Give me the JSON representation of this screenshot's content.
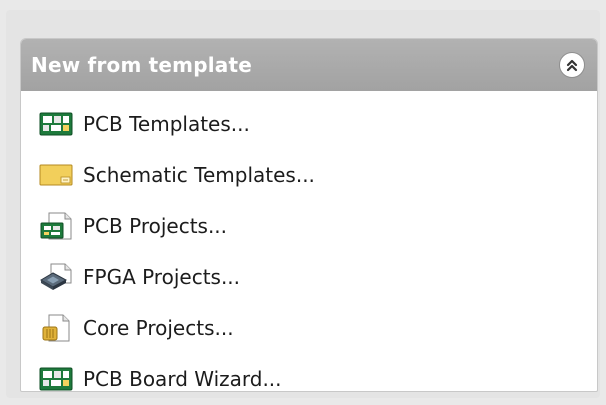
{
  "panel": {
    "title": "New from template",
    "collapse_icon": "double-chevron-up-icon",
    "items": [
      {
        "label": "PCB Templates...",
        "icon": "pcb-template-icon"
      },
      {
        "label": "Schematic Templates...",
        "icon": "schematic-template-icon"
      },
      {
        "label": "PCB Projects...",
        "icon": "pcb-project-icon"
      },
      {
        "label": "FPGA Projects...",
        "icon": "fpga-project-icon"
      },
      {
        "label": "Core Projects...",
        "icon": "core-project-icon"
      },
      {
        "label": "PCB Board Wizard...",
        "icon": "pcb-board-wizard-icon"
      }
    ]
  },
  "colors": {
    "header_bg": "#a8a8a8",
    "header_text": "#ffffff",
    "pcb_green": "#1e7a3c",
    "schematic_yellow": "#f2cf5b",
    "core_gold": "#e0b23a"
  }
}
